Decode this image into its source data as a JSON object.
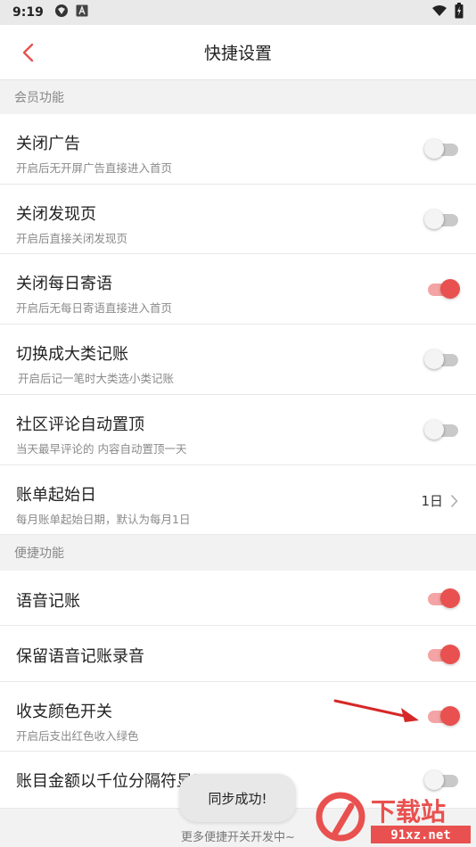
{
  "status_bar": {
    "time": "9:19"
  },
  "header": {
    "title": "快捷设置"
  },
  "sections": [
    {
      "title": "会员功能"
    },
    {
      "title": "便捷功能"
    }
  ],
  "rows": [
    {
      "label": "关闭广告",
      "sub": "开启后无开屏广告直接进入首页",
      "on": false
    },
    {
      "label": "关闭发现页",
      "sub": "开启后直接关闭发现页",
      "on": false
    },
    {
      "label": "关闭每日寄语",
      "sub": "开启后无每日寄语直接进入首页",
      "on": true
    },
    {
      "label": "切换成大类记账",
      "sub": "开启后记一笔时大类选小类记账",
      "on": false
    },
    {
      "label": "社区评论自动置顶",
      "sub": "当天最早评论的 内容自动置顶一天",
      "on": false
    },
    {
      "label": "账单起始日",
      "sub": "每月账单起始日期，默认为每月1日",
      "value": "1日"
    },
    {
      "label": "语音记账",
      "on": true
    },
    {
      "label": "保留语音记账录音",
      "on": true
    },
    {
      "label": "收支颜色开关",
      "sub": "开启后支出红色收入绿色",
      "on": true
    },
    {
      "label": "账目金额以千位分隔符显示",
      "on": false
    }
  ],
  "toast": "同步成功!",
  "footer": "更多便捷开关开发中~",
  "watermark": {
    "big": "下载站",
    "small": "91xz.net"
  },
  "colors": {
    "accent": "#e8514f",
    "toggle_on_track": "#f4a4a4",
    "toggle_off_track": "#c9c9c9"
  }
}
